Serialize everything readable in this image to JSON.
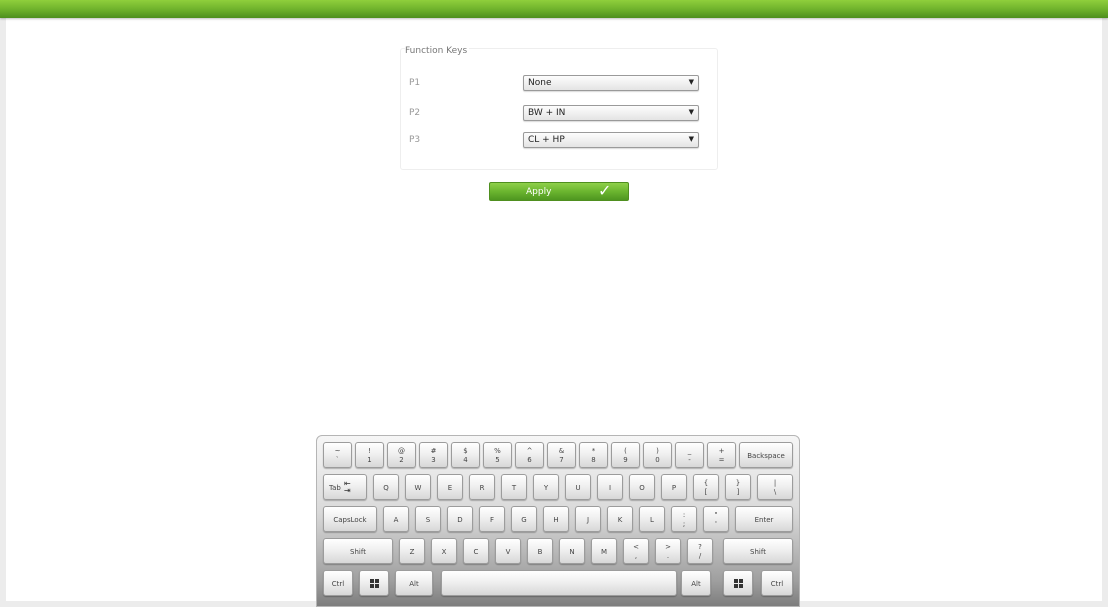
{
  "function_keys": {
    "title": "Function Keys",
    "rows": [
      {
        "label": "P1",
        "value": "None"
      },
      {
        "label": "P2",
        "value": "BW + IN"
      },
      {
        "label": "P3",
        "value": "CL + HP"
      }
    ]
  },
  "apply_label": "Apply",
  "keyboard": {
    "row1": [
      {
        "top": "~",
        "bottom": "`"
      },
      {
        "top": "!",
        "bottom": "1"
      },
      {
        "top": "@",
        "bottom": "2"
      },
      {
        "top": "#",
        "bottom": "3"
      },
      {
        "top": "$",
        "bottom": "4"
      },
      {
        "top": "%",
        "bottom": "5"
      },
      {
        "top": "^",
        "bottom": "6"
      },
      {
        "top": "&",
        "bottom": "7"
      },
      {
        "top": "*",
        "bottom": "8"
      },
      {
        "top": "(",
        "bottom": "9"
      },
      {
        "top": ")",
        "bottom": "0"
      },
      {
        "top": "_",
        "bottom": "-"
      },
      {
        "top": "+",
        "bottom": "="
      }
    ],
    "backspace": "Backspace",
    "tab": "Tab",
    "row2": [
      "Q",
      "W",
      "E",
      "R",
      "T",
      "Y",
      "U",
      "I",
      "O",
      "P"
    ],
    "row2_sym": [
      {
        "top": "{",
        "bottom": "["
      },
      {
        "top": "}",
        "bottom": "]"
      },
      {
        "top": "|",
        "bottom": "\\"
      }
    ],
    "capslock": "CapsLock",
    "row3": [
      "A",
      "S",
      "D",
      "F",
      "G",
      "H",
      "J",
      "K",
      "L"
    ],
    "row3_sym": [
      {
        "top": ":",
        "bottom": ";"
      },
      {
        "top": "\"",
        "bottom": "'"
      }
    ],
    "enter": "Enter",
    "shift": "Shift",
    "row4": [
      "Z",
      "X",
      "C",
      "V",
      "B",
      "N",
      "M"
    ],
    "row4_sym": [
      {
        "top": "<",
        "bottom": ","
      },
      {
        "top": ">",
        "bottom": "."
      },
      {
        "top": "?",
        "bottom": "/"
      }
    ],
    "ctrl": "Ctrl",
    "alt": "Alt"
  }
}
